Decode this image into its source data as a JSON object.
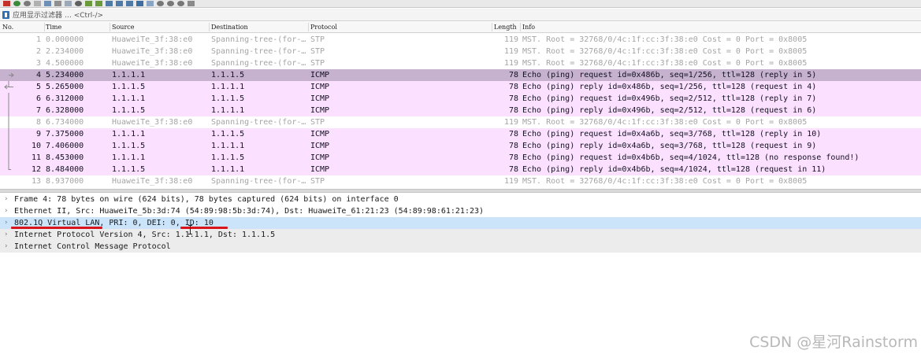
{
  "filter": {
    "placeholder": "应用显示过滤器 … <Ctrl-/>"
  },
  "columns": {
    "no": "No.",
    "time": "Time",
    "source": "Source",
    "destination": "Destination",
    "protocol": "Protocol",
    "length": "Length",
    "info": "Info"
  },
  "packets": [
    {
      "no": "1",
      "time": "0.000000",
      "source": "HuaweiTe_3f:38:e0",
      "destination": "Spanning-tree-(for-…",
      "protocol": "STP",
      "length": "119",
      "info": "MST. Root = 32768/0/4c:1f:cc:3f:38:e0  Cost = 0  Port = 0x8005"
    },
    {
      "no": "2",
      "time": "2.234000",
      "source": "HuaweiTe_3f:38:e0",
      "destination": "Spanning-tree-(for-…",
      "protocol": "STP",
      "length": "119",
      "info": "MST. Root = 32768/0/4c:1f:cc:3f:38:e0  Cost = 0  Port = 0x8005"
    },
    {
      "no": "3",
      "time": "4.500000",
      "source": "HuaweiTe_3f:38:e0",
      "destination": "Spanning-tree-(for-…",
      "protocol": "STP",
      "length": "119",
      "info": "MST. Root = 32768/0/4c:1f:cc:3f:38:e0  Cost = 0  Port = 0x8005"
    },
    {
      "no": "4",
      "time": "5.234000",
      "source": "1.1.1.1",
      "destination": "1.1.1.5",
      "protocol": "ICMP",
      "length": "78",
      "info": "Echo (ping) request  id=0x486b, seq=1/256, ttl=128 (reply in 5)"
    },
    {
      "no": "5",
      "time": "5.265000",
      "source": "1.1.1.5",
      "destination": "1.1.1.1",
      "protocol": "ICMP",
      "length": "78",
      "info": "Echo (ping) reply    id=0x486b, seq=1/256, ttl=128 (request in 4)"
    },
    {
      "no": "6",
      "time": "6.312000",
      "source": "1.1.1.1",
      "destination": "1.1.1.5",
      "protocol": "ICMP",
      "length": "78",
      "info": "Echo (ping) request  id=0x496b, seq=2/512, ttl=128 (reply in 7)"
    },
    {
      "no": "7",
      "time": "6.328000",
      "source": "1.1.1.5",
      "destination": "1.1.1.1",
      "protocol": "ICMP",
      "length": "78",
      "info": "Echo (ping) reply    id=0x496b, seq=2/512, ttl=128 (request in 6)"
    },
    {
      "no": "8",
      "time": "6.734000",
      "source": "HuaweiTe_3f:38:e0",
      "destination": "Spanning-tree-(for-…",
      "protocol": "STP",
      "length": "119",
      "info": "MST. Root = 32768/0/4c:1f:cc:3f:38:e0  Cost = 0  Port = 0x8005"
    },
    {
      "no": "9",
      "time": "7.375000",
      "source": "1.1.1.1",
      "destination": "1.1.1.5",
      "protocol": "ICMP",
      "length": "78",
      "info": "Echo (ping) request  id=0x4a6b, seq=3/768, ttl=128 (reply in 10)"
    },
    {
      "no": "10",
      "time": "7.406000",
      "source": "1.1.1.5",
      "destination": "1.1.1.1",
      "protocol": "ICMP",
      "length": "78",
      "info": "Echo (ping) reply    id=0x4a6b, seq=3/768, ttl=128 (request in 9)"
    },
    {
      "no": "11",
      "time": "8.453000",
      "source": "1.1.1.1",
      "destination": "1.1.1.5",
      "protocol": "ICMP",
      "length": "78",
      "info": "Echo (ping) request  id=0x4b6b, seq=4/1024, ttl=128 (no response found!)"
    },
    {
      "no": "12",
      "time": "8.484000",
      "source": "1.1.1.5",
      "destination": "1.1.1.1",
      "protocol": "ICMP",
      "length": "78",
      "info": "Echo (ping) reply    id=0x4b6b, seq=4/1024, ttl=128 (request in 11)"
    },
    {
      "no": "13",
      "time": "8.937000",
      "source": "HuaweiTe_3f:38:e0",
      "destination": "Spanning-tree-(for-…",
      "protocol": "STP",
      "length": "119",
      "info": "MST. Root = 32768/0/4c:1f:cc:3f:38:e0  Cost = 0  Port = 0x8005"
    }
  ],
  "selected_packet": "4",
  "details": [
    {
      "text": "Frame 4: 78 bytes on wire (624 bits), 78 bytes captured (624 bits) on interface 0"
    },
    {
      "text": "Ethernet II, Src: HuaweiTe_5b:3d:74 (54:89:98:5b:3d:74), Dst: HuaweiTe_61:21:23 (54:89:98:61:21:23)"
    },
    {
      "text": "802.1Q Virtual LAN, PRI: 0, DEI: 0, ID: 10"
    },
    {
      "text": "Internet Protocol Version 4, Src: 1.1.1.1, Dst: 1.1.1.5"
    },
    {
      "text": "Internet Control Message Protocol"
    }
  ],
  "colors": {
    "icmp_row": "#fce0ff",
    "selected_row": "#c6b1cf",
    "stp_text": "#a5a5a5",
    "detail_selected": "#cbe4fa",
    "underline": "#d9141a"
  },
  "watermark": "CSDN @星河Rainstorm"
}
